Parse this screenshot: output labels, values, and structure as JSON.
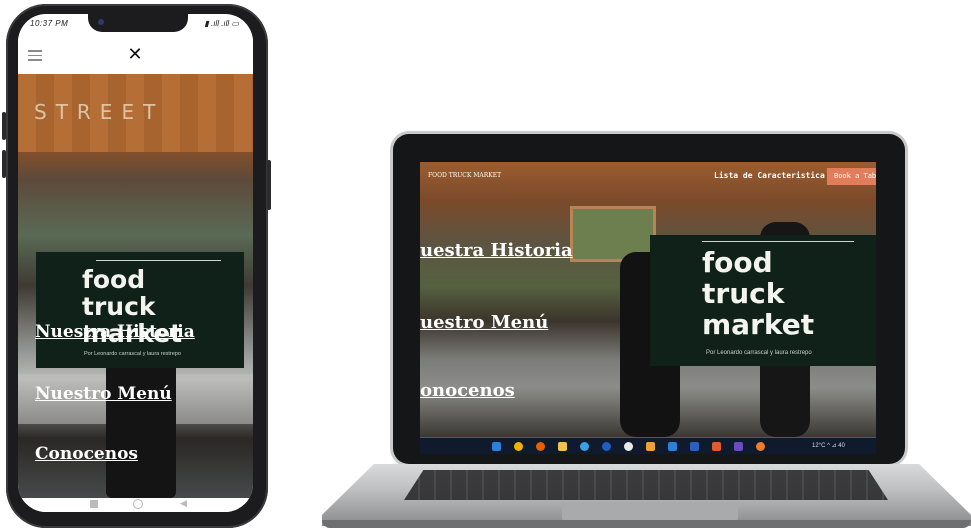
{
  "phone": {
    "status": {
      "left": "10:37 PM",
      "right": "▮ .ıll .ıll ▭"
    },
    "header": {
      "logo_icon": "fork-knife-icon",
      "logo_glyph": "✕"
    },
    "hero": {
      "sign_text": "STREET"
    },
    "brand": {
      "title_line1": "food",
      "title_line2": "truck",
      "title_line3": "market",
      "subtitle": "Por Leonardo carrascal y laura restrepo"
    },
    "nav_links": [
      "Nuestra Historia",
      "Nuestro Menú",
      "Conocenos"
    ],
    "system_nav": {
      "recent": "■",
      "home": "◉",
      "back": "◀"
    }
  },
  "laptop": {
    "topbar": {
      "brand": "FOOD TRUCK MARKET",
      "features_link": "Lista de Caracteristica",
      "book_button": "Book a Tab"
    },
    "brand": {
      "title_line1": "food",
      "title_line2": "truck",
      "title_line3": "market",
      "subtitle": "Por Leonardo carrascal y laura restrepo"
    },
    "nav_links": [
      "uestra Historia",
      "uestro Menú",
      "onocenos"
    ],
    "taskbar": {
      "weather": "12°C",
      "tray": "^ ⊿ 40"
    }
  },
  "colors": {
    "brand_box": "#0f2119",
    "accent_button": "#e27d5b",
    "taskbar": "#0f1a2c"
  }
}
